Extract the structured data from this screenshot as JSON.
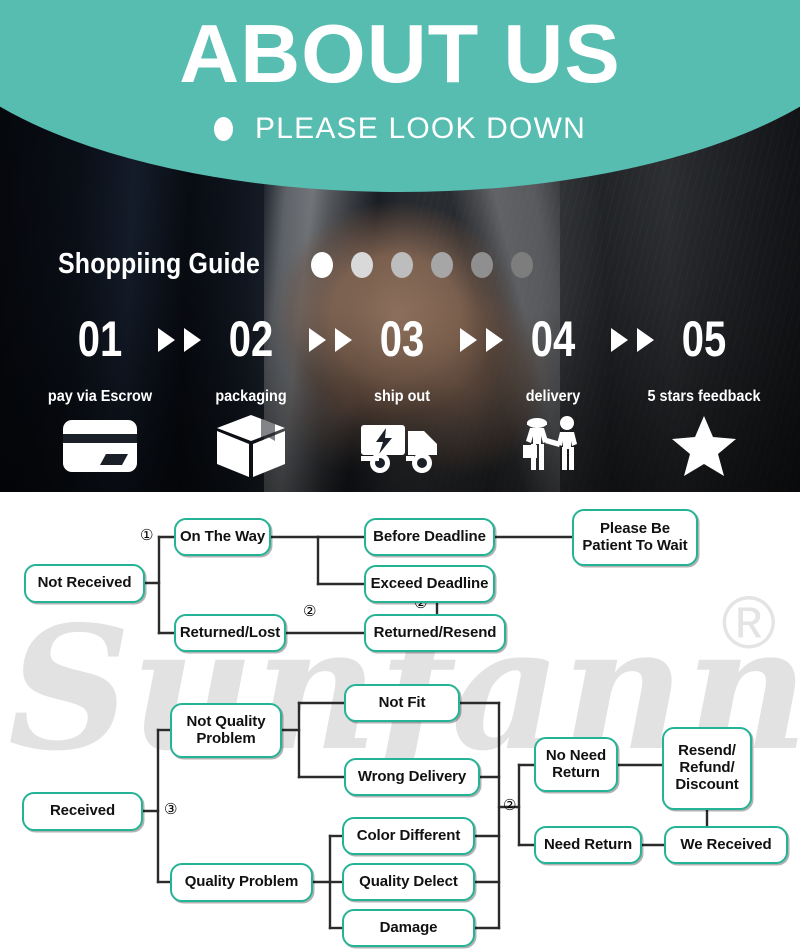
{
  "hero": {
    "title": "ABOUT US",
    "subtitle": "PLEASE LOOK DOWN",
    "dot_icon": "bullet-dot",
    "teal": "#56bdb0"
  },
  "guide": {
    "title": "Shoppiing Guide",
    "dots": [
      "#ffffff",
      "#d9d9d9",
      "#bdbdbd",
      "#a6a6a6",
      "#8f8f8f",
      "#7d7d7d"
    ],
    "steps": [
      {
        "num": "01",
        "label": "pay via Escrow",
        "icon": "credit-card-icon"
      },
      {
        "num": "02",
        "label": "packaging",
        "icon": "box-package-icon"
      },
      {
        "num": "03",
        "label": "ship out",
        "icon": "delivery-truck-icon"
      },
      {
        "num": "04",
        "label": "delivery",
        "icon": "courier-handoff-icon"
      },
      {
        "num": "05",
        "label": "5 stars feedback",
        "icon": "star-icon"
      }
    ],
    "arrow_icon": "double-triangle-right-icon"
  },
  "watermark": {
    "text": "Sunfanny",
    "registered_mark": "®"
  },
  "flow": {
    "accent": "#25b396",
    "markers": {
      "one": "①",
      "two": "②",
      "three": "③"
    },
    "nodes": {
      "not_received": "Not Received",
      "on_the_way": "On The Way",
      "returned_lost": "Returned/Lost",
      "before_deadline": "Before Deadline",
      "exceed_deadline": "Exceed Deadline",
      "returned_resend": "Returned/Resend",
      "please_be_patient": "Please Be\nPatient To Wait",
      "received": "Received",
      "not_quality_problem": "Not Quality\nProblem",
      "quality_problem": "Quality Problem",
      "not_fit": "Not Fit",
      "wrong_delivery": "Wrong Delivery",
      "color_different": "Color Different",
      "quality_delect": "Quality Delect",
      "damage": "Damage",
      "no_need_return": "No Need\nReturn",
      "need_return": "Need Return",
      "resend_refund_discount": "Resend/\nRefund/\nDiscount",
      "we_received": "We Received"
    },
    "marker_labels": {
      "m1": "①",
      "m2a": "②",
      "m2b": "②",
      "m2c": "②",
      "m3": "③"
    }
  }
}
